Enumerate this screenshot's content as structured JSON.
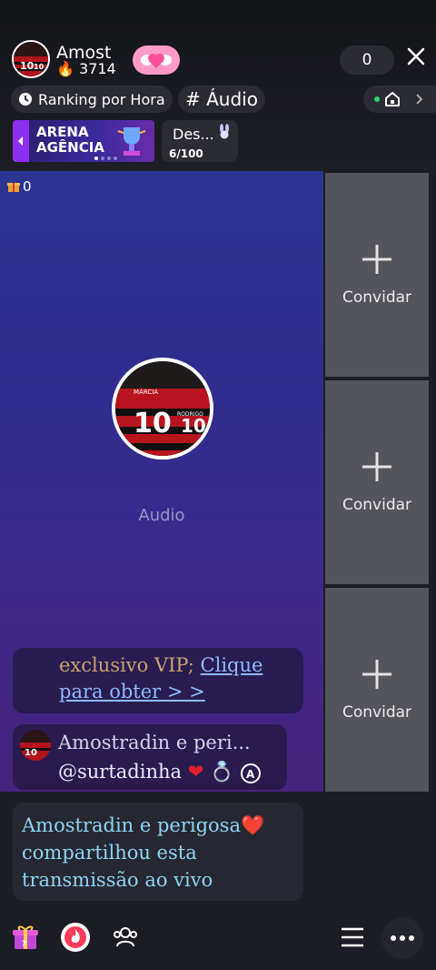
{
  "host": {
    "name": "Amost",
    "score": "3714"
  },
  "viewer_count": "0",
  "ranking_label": "Ranking por Hora",
  "tag_label": "# Áudio",
  "arena": {
    "line1": "ARENA",
    "line2": "AGÊNCIA"
  },
  "desafio": {
    "label": "Des...",
    "progress": "6/100"
  },
  "stage": {
    "gift_count": "0",
    "label": "Audio"
  },
  "seats": [
    {
      "label": "Convidar"
    },
    {
      "label": "Convidar"
    },
    {
      "label": "Convidar"
    }
  ],
  "chat": {
    "vip_prefix": "exclusivo VIP; ",
    "vip_link": "Clique para obter > >",
    "msg_name": "Amostradin e peri...",
    "msg_mention": "@surtadinha",
    "share_text": "Amostradin e perigosa❤️ compartilhou esta transmissão ao vivo"
  },
  "icons": {
    "close": "close-icon",
    "clock": "clock-icon",
    "home": "home-icon",
    "gift": "gift-icon",
    "fire": "fire-icon",
    "people": "people-icon",
    "menu": "menu-icon",
    "more": "more-icon"
  }
}
